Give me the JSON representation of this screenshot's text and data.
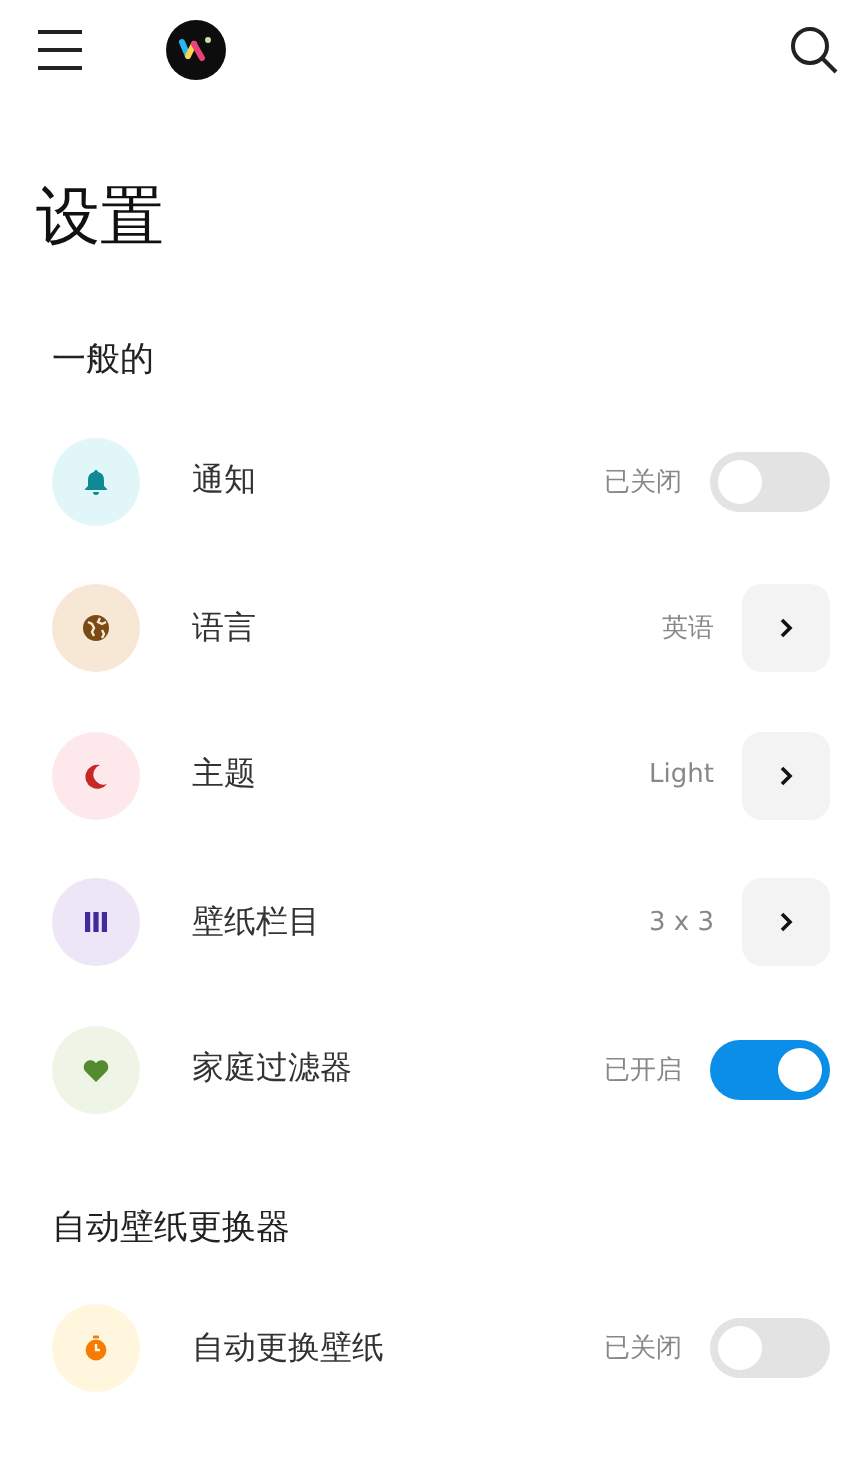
{
  "title": "设置",
  "sections": [
    {
      "heading": "一般的",
      "items": [
        {
          "kind": "toggle",
          "label": "通知",
          "value": "已关闭",
          "on": false
        },
        {
          "kind": "link",
          "label": "语言",
          "value": "英语"
        },
        {
          "kind": "link",
          "label": "主题",
          "value": "Light"
        },
        {
          "kind": "link",
          "label": "壁纸栏目",
          "value": "3 x 3"
        },
        {
          "kind": "toggle",
          "label": "家庭过滤器",
          "value": "已开启",
          "on": true
        }
      ]
    },
    {
      "heading": "自动壁纸更换器",
      "items": [
        {
          "kind": "toggle",
          "label": "自动更换壁纸",
          "value": "已关闭",
          "on": false
        }
      ]
    }
  ]
}
